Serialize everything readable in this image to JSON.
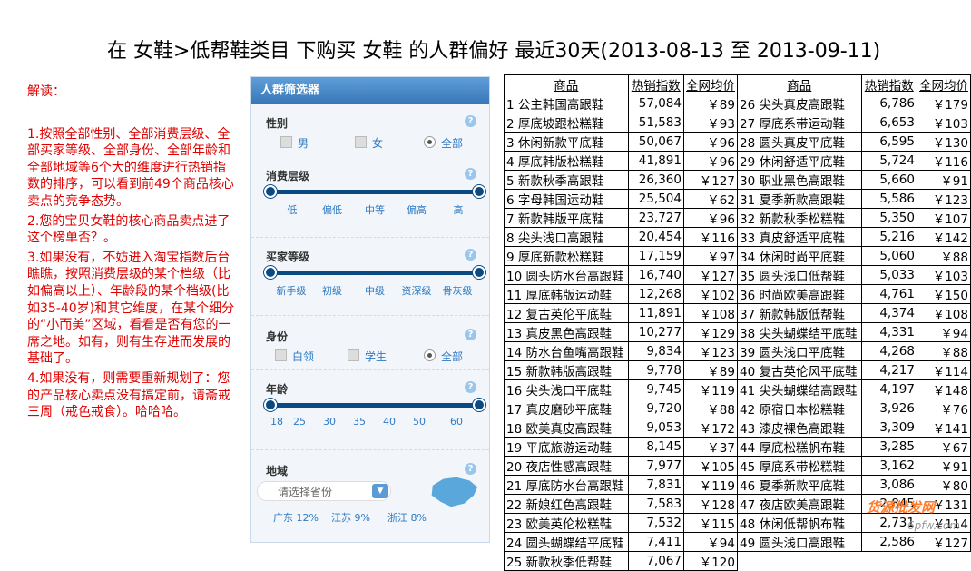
{
  "title": "在 女鞋>低帮鞋类目 下购买 女鞋 的人群偏好 最近30天(2013-08-13 至 2013-09-11)",
  "commentary": {
    "heading": "解读：",
    "p1": "1.按照全部性别、全部消费层级、全部买家等级、全部身份、全部年龄和全部地域等6个大的维度进行热销指数的排序，可以看到前49个商品核心卖点的竞争态势。",
    "p2": "2.您的宝贝女鞋的核心商品卖点进了这个榜单否？。",
    "p3": "3.如果没有，不妨进入淘宝指数后台瞧瞧，按照消费层级的某个档级（比如偏高以上）、年龄段的某个档级(比如35-40岁)和其它维度，在某个细分的“小而美”区域，看看是否有您的一席之地。如有，则有生存进而发展的基础了。",
    "p4": "4.如果没有，则需要重新规划了：您的产品核心卖点没有搞定前，请斋戒三周（戒色戒食）。哈哈哈。"
  },
  "filter": {
    "title": "人群筛选器",
    "help": "?",
    "gender": {
      "label": "性别",
      "options": [
        "男",
        "女",
        "全部"
      ],
      "selected": "全部"
    },
    "consumption": {
      "label": "消费层级",
      "ticks": [
        "低",
        "偏低",
        "中等",
        "偏高",
        "高"
      ]
    },
    "buyer_level": {
      "label": "买家等级",
      "ticks": [
        "新手级",
        "初级",
        "中级",
        "资深级",
        "骨灰级"
      ]
    },
    "identity": {
      "label": "身份",
      "options": [
        "白领",
        "学生",
        "全部"
      ],
      "selected": "全部"
    },
    "age": {
      "label": "年龄",
      "ticks": [
        "18",
        "25",
        "30",
        "35",
        "40",
        "50",
        "60"
      ]
    },
    "region": {
      "label": "地域",
      "placeholder": "请选择省份",
      "stats": [
        "广东 12%",
        "江苏 9%",
        "浙江 8%"
      ]
    }
  },
  "table": {
    "headers": [
      "商品",
      "热销指数",
      "全网均价",
      "商品",
      "热销指数",
      "全网均价"
    ],
    "rows": [
      [
        "1 公主韩国高跟鞋",
        "57,084",
        "￥89",
        "26 尖头真皮高跟鞋",
        "6,786",
        "￥179"
      ],
      [
        "2 厚底坡跟松糕鞋",
        "51,583",
        "￥93",
        "27 厚底系带运动鞋",
        "6,653",
        "￥103"
      ],
      [
        "3 休闲新款平底鞋",
        "50,067",
        "￥96",
        "28 圆头真皮平底鞋",
        "6,595",
        "￥130"
      ],
      [
        "4 厚底韩版松糕鞋",
        "41,891",
        "￥96",
        "29 休闲舒适平底鞋",
        "5,724",
        "￥116"
      ],
      [
        "5 新款秋季高跟鞋",
        "26,360",
        "￥127",
        "30 职业黑色高跟鞋",
        "5,660",
        "￥91"
      ],
      [
        "6 字母韩国运动鞋",
        "25,504",
        "￥62",
        "31 夏季新款高跟鞋",
        "5,586",
        "￥123"
      ],
      [
        "7 新款韩版平底鞋",
        "23,727",
        "￥96",
        "32 新款秋季松糕鞋",
        "5,350",
        "￥107"
      ],
      [
        "8 尖头浅口高跟鞋",
        "20,454",
        "￥116",
        "33 真皮舒适平底鞋",
        "5,216",
        "￥142"
      ],
      [
        "9 厚底新款松糕鞋",
        "17,159",
        "￥97",
        "34 休闲时尚平底鞋",
        "5,060",
        "￥88"
      ],
      [
        "10 圆头防水台高跟鞋",
        "16,740",
        "￥127",
        "35 圆头浅口低帮鞋",
        "5,033",
        "￥103"
      ],
      [
        "11 厚底韩版运动鞋",
        "12,268",
        "￥102",
        "36 时尚欧美高跟鞋",
        "4,761",
        "￥150"
      ],
      [
        "12 复古英伦平底鞋",
        "11,891",
        "￥108",
        "37 新款韩版低帮鞋",
        "4,374",
        "￥108"
      ],
      [
        "13 真皮黑色高跟鞋",
        "10,277",
        "￥129",
        "38 尖头蝴蝶结平底鞋",
        "4,331",
        "￥94"
      ],
      [
        "14 防水台鱼嘴高跟鞋",
        "9,834",
        "￥123",
        "39 圆头浅口平底鞋",
        "4,268",
        "￥88"
      ],
      [
        "15 新款韩版高跟鞋",
        "9,778",
        "￥89",
        "40 复古英伦风平底鞋",
        "4,217",
        "￥114"
      ],
      [
        "16 尖头浅口平底鞋",
        "9,745",
        "￥119",
        "41 尖头蝴蝶结高跟鞋",
        "4,197",
        "￥148"
      ],
      [
        "17 真皮磨砂平底鞋",
        "9,720",
        "￥88",
        "42 原宿日本松糕鞋",
        "3,926",
        "￥76"
      ],
      [
        "18 欧美真皮高跟鞋",
        "9,053",
        "￥172",
        "43 漆皮裸色高跟鞋",
        "3,309",
        "￥141"
      ],
      [
        "19 平底旅游运动鞋",
        "8,145",
        "￥37",
        "44 厚底松糕帆布鞋",
        "3,285",
        "￥67"
      ],
      [
        "20 夜店性感高跟鞋",
        "7,977",
        "￥105",
        "45 厚底系带松糕鞋",
        "3,162",
        "￥91"
      ],
      [
        "21 厚底防水台高跟鞋",
        "7,831",
        "￥119",
        "46 夏季新款平底鞋",
        "3,086",
        "￥80"
      ],
      [
        "22 新娘红色高跟鞋",
        "7,583",
        "￥128",
        "47 夜店欧美高跟鞋",
        "2,845",
        "￥131"
      ],
      [
        "23 欧美英伦松糕鞋",
        "7,532",
        "￥115",
        "48 休闲低帮帆布鞋",
        "2,731",
        "￥114"
      ],
      [
        "24 圆头蝴蝶结平底鞋",
        "7,411",
        "￥94",
        "49 圆头浅口高跟鞋",
        "2,586",
        "￥127"
      ],
      [
        "25 新款秋季低帮鞋",
        "7,067",
        "￥120",
        "",
        "",
        ""
      ]
    ]
  },
  "watermark": {
    "cn": "货源批发网",
    "url": "6pfw.com"
  }
}
